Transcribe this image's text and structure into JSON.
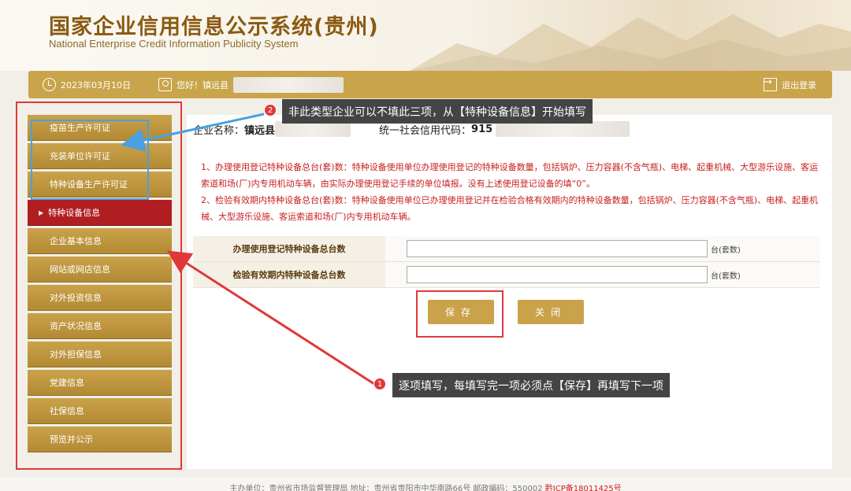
{
  "header": {
    "title": "国家企业信用信息公示系统(贵州)",
    "subtitle": "National Enterprise Credit Information Publicity System"
  },
  "topbar": {
    "date": "2023年03月10日",
    "greeting": "您好！镇远县",
    "logout": "退出登录"
  },
  "sidebar": {
    "items": [
      {
        "label": "疫苗生产许可证"
      },
      {
        "label": "充装单位许可证"
      },
      {
        "label": "特种设备生产许可证"
      },
      {
        "label": "特种设备信息",
        "active": true
      },
      {
        "label": "企业基本信息"
      },
      {
        "label": "网站或网店信息"
      },
      {
        "label": "对外投资信息"
      },
      {
        "label": "资产状况信息"
      },
      {
        "label": "对外担保信息"
      },
      {
        "label": "党建信息"
      },
      {
        "label": "社保信息"
      },
      {
        "label": "预览并公示"
      }
    ]
  },
  "main": {
    "company_label": "企业名称：",
    "company_value": "镇远县",
    "credit_code_label": "统一社会信用代码：",
    "credit_code_value": "915",
    "note1": "1、办理使用登记特种设备总台(套)数：特种设备使用单位办理使用登记的特种设备数量，包括锅炉、压力容器(不含气瓶)、电梯、起重机械、大型游乐设施、客运索道和场(厂)内专用机动车辆，由实际办理使用登记手续的单位填报。没有上述使用登记设备的填“0”。",
    "note2": "2、检验有效期内特种设备总台(套)数：特种设备使用单位已办理使用登记并在检验合格有效期内的特种设备数量，包括锅炉、压力容器(不含气瓶)、电梯、起重机械、大型游乐设施、客运索道和场(厂)内专用机动车辆。",
    "form": {
      "row1_label": "办理使用登记特种设备总台数",
      "row1_value": "",
      "row2_label": "检验有效期内特种设备总台数",
      "row2_value": "",
      "unit": "台(套数)"
    },
    "save_button": "保存",
    "close_button": "关闭"
  },
  "annotations": {
    "callout1_num": "1",
    "callout1_text": "逐项填写，每填写完一项必须点【保存】再填写下一项",
    "callout2_num": "2",
    "callout2_text": "非此类型企业可以不填此三项，从【特种设备信息】开始填写"
  },
  "footer": {
    "text": "主办单位：贵州省市场监督管理局  地址：贵州省贵阳市中华南路66号  邮政编码：550002  ",
    "icp": "黔ICP备18011425号"
  },
  "colors": {
    "gold": "#caa24a",
    "active_red": "#b01e22",
    "annotation_red": "#e0383a",
    "annotation_blue": "#4aa0e0"
  }
}
